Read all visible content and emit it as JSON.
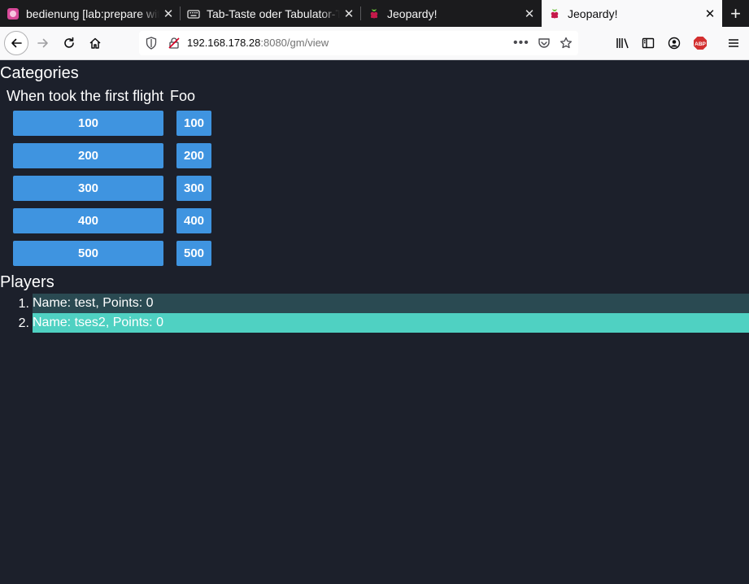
{
  "browser": {
    "tabs": [
      {
        "title": "bedienung [lab:prepare with",
        "icon": "wiki-icon"
      },
      {
        "title": "Tab-Taste oder Tabulator-Taste",
        "icon": "keyboard-icon"
      },
      {
        "title": "Jeopardy!",
        "icon": "raspberry-icon"
      },
      {
        "title": "Jeopardy!",
        "icon": "raspberry-icon",
        "selected": true
      }
    ],
    "close_glyph": "✕",
    "new_tab_glyph": "+",
    "url": {
      "host": "192.168.178.28",
      "rest": ":8080/gm/view"
    }
  },
  "page": {
    "categories_heading": "Categories",
    "players_heading": "Players",
    "categories": [
      {
        "title": "When took the first flight",
        "questions": [
          "100",
          "200",
          "300",
          "400",
          "500"
        ]
      },
      {
        "title": "Foo",
        "questions": [
          "100",
          "200",
          "300",
          "400",
          "500"
        ]
      }
    ],
    "players": [
      {
        "number": "1.",
        "label": "Name: test, Points: 0",
        "color": "#2a4a52"
      },
      {
        "number": "2.",
        "label": "Name: tses2, Points: 0",
        "color": "#4fd1c2"
      }
    ]
  },
  "colors": {
    "page_background": "#1c202b",
    "question_button": "#3f94e0",
    "abp_red": "#d32f2f"
  }
}
